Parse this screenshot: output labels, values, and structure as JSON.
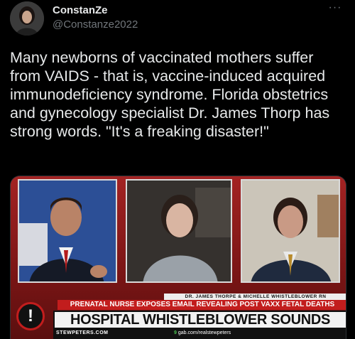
{
  "author": {
    "display_name": "ConstanZe",
    "handle": "@Constanze2022",
    "avatar_icon": "user-avatar"
  },
  "more_icon": "more-options-icon",
  "tweet_text": "Many newborns of vaccinated mothers suffer from VAIDS - that is, vaccine-induced acquired immunodeficiency syndrome. Florida obstetrics and gynecology specialist Dr. James Thorp has strong words. \"It's a freaking disaster!\"",
  "media": {
    "guest_names": "DR. JAMES THORPE & MICHELLE WHISTLEBLOWER RN",
    "subheadline": "PRENATAL NURSE EXPOSES EMAIL REVEALING POST VAXX FETAL DEATHS",
    "headline": "HOSPITAL WHISTLEBLOWER SOUNDS ALARM",
    "badge": "!",
    "site": "STEWPETERS.COM",
    "gab_prefix": "9",
    "gab_url": "gab.com/realstewpeters",
    "colors": {
      "ribbon_red": "#c21d1d",
      "background_red": "#a32323"
    }
  }
}
